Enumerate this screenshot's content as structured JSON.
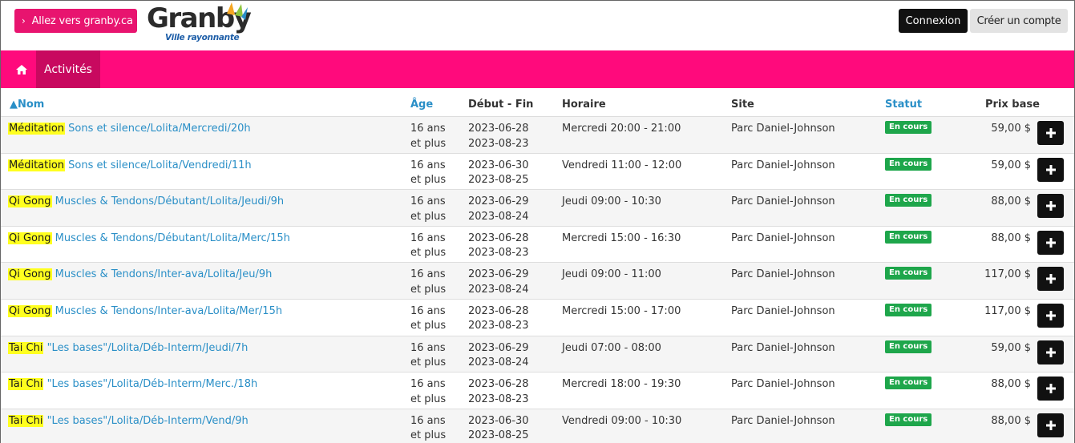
{
  "header": {
    "goto_label": "Allez vers granby.ca",
    "logo_word": "Granby",
    "logo_tagline": "Ville rayonnante",
    "login_label": "Connexion",
    "create_account_label": "Créer un compte"
  },
  "nav": {
    "active_tab": "Activités"
  },
  "colors": {
    "accent_pink": "#ff0a7c",
    "active_tab": "#c8095f",
    "link_blue": "#2a8fc7",
    "status_green": "#1ea64b",
    "highlight": "#ffff1f"
  },
  "table": {
    "columns": {
      "nom": "Nom",
      "age": "Âge",
      "dates": "Début - Fin",
      "horaire": "Horaire",
      "site": "Site",
      "statut": "Statut",
      "prix": "Prix base"
    },
    "rows": [
      {
        "hl": "Méditation",
        "rest": " Sons et silence/Lolita/Mercredi/20h",
        "age1": "16 ans",
        "age2": "et plus",
        "start": "2023-06-28",
        "end": "2023-08-23",
        "sched": "Mercredi 20:00 - 21:00",
        "site": "Parc Daniel-Johnson",
        "status": "En cours",
        "price": "59,00 $"
      },
      {
        "hl": "Méditation",
        "rest": " Sons et silence/Lolita/Vendredi/11h",
        "age1": "16 ans",
        "age2": "et plus",
        "start": "2023-06-30",
        "end": "2023-08-25",
        "sched": "Vendredi 11:00 - 12:00",
        "site": "Parc Daniel-Johnson",
        "status": "En cours",
        "price": "59,00 $"
      },
      {
        "hl": "Qi Gong",
        "rest": " Muscles & Tendons/Débutant/Lolita/Jeudi/9h",
        "age1": "16 ans",
        "age2": "et plus",
        "start": "2023-06-29",
        "end": "2023-08-24",
        "sched": "Jeudi 09:00 - 10:30",
        "site": "Parc Daniel-Johnson",
        "status": "En cours",
        "price": "88,00 $"
      },
      {
        "hl": "Qi Gong",
        "rest": " Muscles & Tendons/Débutant/Lolita/Merc/15h",
        "age1": "16 ans",
        "age2": "et plus",
        "start": "2023-06-28",
        "end": "2023-08-23",
        "sched": "Mercredi 15:00 - 16:30",
        "site": "Parc Daniel-Johnson",
        "status": "En cours",
        "price": "88,00 $"
      },
      {
        "hl": "Qi Gong",
        "rest": " Muscles & Tendons/Inter-ava/Lolita/Jeu/9h",
        "age1": "16 ans",
        "age2": "et plus",
        "start": "2023-06-29",
        "end": "2023-08-24",
        "sched": "Jeudi 09:00 - 11:00",
        "site": "Parc Daniel-Johnson",
        "status": "En cours",
        "price": "117,00 $"
      },
      {
        "hl": "Qi Gong",
        "rest": " Muscles & Tendons/Inter-ava/Lolita/Mer/15h",
        "age1": "16 ans",
        "age2": "et plus",
        "start": "2023-06-28",
        "end": "2023-08-23",
        "sched": "Mercredi 15:00 - 17:00",
        "site": "Parc Daniel-Johnson",
        "status": "En cours",
        "price": "117,00 $"
      },
      {
        "hl": "Tai Chi",
        "rest": " \"Les bases\"/Lolita/Déb-Interm/Jeudi/7h",
        "age1": "16 ans",
        "age2": "et plus",
        "start": "2023-06-29",
        "end": "2023-08-24",
        "sched": "Jeudi 07:00 - 08:00",
        "site": "Parc Daniel-Johnson",
        "status": "En cours",
        "price": "59,00 $"
      },
      {
        "hl": "Tai Chi",
        "rest": " \"Les bases\"/Lolita/Déb-Interm/Merc./18h",
        "age1": "16 ans",
        "age2": "et plus",
        "start": "2023-06-28",
        "end": "2023-08-23",
        "sched": "Mercredi 18:00 - 19:30",
        "site": "Parc Daniel-Johnson",
        "status": "En cours",
        "price": "88,00 $"
      },
      {
        "hl": "Tai Chi",
        "rest": " \"Les bases\"/Lolita/Déb-Interm/Vend/9h",
        "age1": "16 ans",
        "age2": "et plus",
        "start": "2023-06-30",
        "end": "2023-08-25",
        "sched": "Vendredi 09:00 - 10:30",
        "site": "Parc Daniel-Johnson",
        "status": "En cours",
        "price": "88,00 $"
      }
    ]
  }
}
